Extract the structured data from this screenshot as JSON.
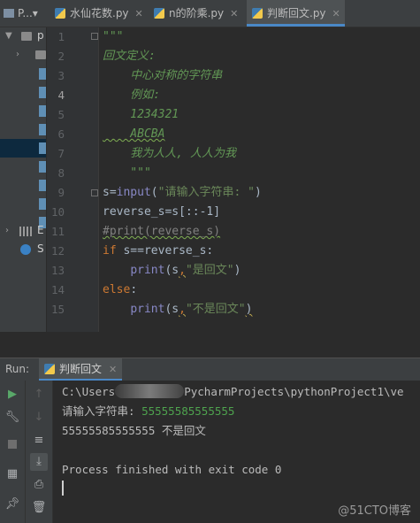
{
  "tabbar": {
    "project_label": "P...▾",
    "tabs": [
      {
        "label": "水仙花数.py",
        "close": "✕"
      },
      {
        "label": "n的阶乘.py",
        "close": "✕"
      },
      {
        "label": "判断回文.py",
        "close": "✕"
      }
    ]
  },
  "tree": {
    "root_label": "p",
    "libs_label": "E",
    "scratch_label": "S"
  },
  "editor": {
    "line_numbers": [
      "1",
      "2",
      "3",
      "4",
      "5",
      "6",
      "7",
      "8",
      "9",
      "10",
      "11",
      "12",
      "13",
      "14",
      "15"
    ],
    "current_line": "4",
    "docstring": {
      "open": "\"\"\"",
      "line2": "回文定义:",
      "line3": "    中心对称的字符串",
      "line4": "    例如:",
      "line5": "    1234321",
      "line6": "    ABCBA",
      "line7": "    我为人人, 人人为我",
      "close": "    \"\"\""
    },
    "line9": {
      "var": "s",
      "eq": "=",
      "fn": "input",
      "arg": "\"请输入字符串: \"",
      "close": ")"
    },
    "line10": {
      "var": "reverse_s",
      "eq": "=",
      "rest": "s[::-1]"
    },
    "line11": {
      "comment": "#print(reverse_s)"
    },
    "line12": {
      "kw": "if",
      "rest": " s==reverse_s:"
    },
    "line13": {
      "fn": "print",
      "open": "(s",
      "comma": ",",
      "str": "\"是回文\"",
      "close": ")"
    },
    "line14": {
      "kw": "else",
      "colon": ":"
    },
    "line15": {
      "fn": "print",
      "open": "(s",
      "comma": ",",
      "str": "\"不是回文\"",
      "close": ")"
    }
  },
  "run": {
    "label": "Run:",
    "tab_label": "判断回文",
    "tab_close": "✕",
    "console": {
      "path_prefix": "C:\\Users",
      "path_suffix": "PycharmProjects\\pythonProject1\\ve",
      "prompt": "请输入字符串: ",
      "input_value": "55555585555555",
      "output": "55555585555555 不是回文",
      "exit": "Process finished with exit code 0"
    }
  },
  "watermark": "@51CTO博客"
}
